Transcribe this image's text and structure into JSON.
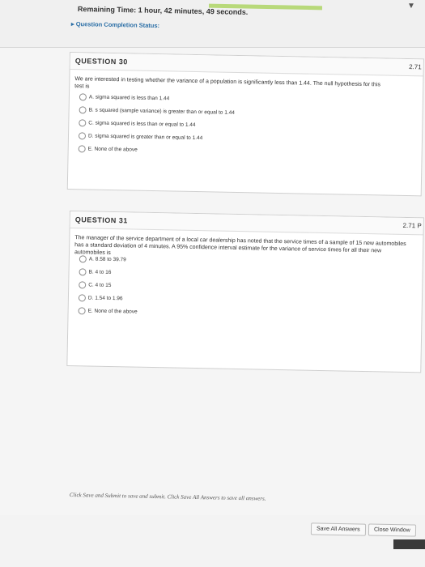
{
  "timer": {
    "text": "Remaining Time: 1 hour, 42 minutes, 49 seconds.",
    "completion_label": "Question Completion Status:"
  },
  "questions": [
    {
      "title": "QUESTION 30",
      "points": "2.71",
      "text": "We are interested in testing whether the variance of a population is significantly less than 1.44. The null hypothesis for this test is",
      "options": [
        "A. sigma squared is less than 1.44",
        "B. s squared (sample variance) is greater than or equal to 1.44",
        "C. sigma squared is less than or equal to 1.44",
        "D. sigma squared is greater than or equal to 1.44",
        "E. None of the above"
      ]
    },
    {
      "title": "QUESTION 31",
      "points": "2.71 P",
      "text": "The manager of the service department of a local car dealership has noted that the service times of a sample of 15 new automobiles has a standard deviation of 4 minutes. A 95% confidence interval estimate for the variance of service times for all their new automobiles is",
      "options": [
        "A. 8.58 to 39.79",
        "B. 4 to 16",
        "C. 4 to 15",
        "D. 1.54 to 1.96",
        "E. None of the above"
      ]
    }
  ],
  "footer": {
    "note": "Click Save and Submit to save and submit. Click Save All Answers to save all answers.",
    "save_all_label": "Save All Answers",
    "close_label": "Close Window"
  }
}
